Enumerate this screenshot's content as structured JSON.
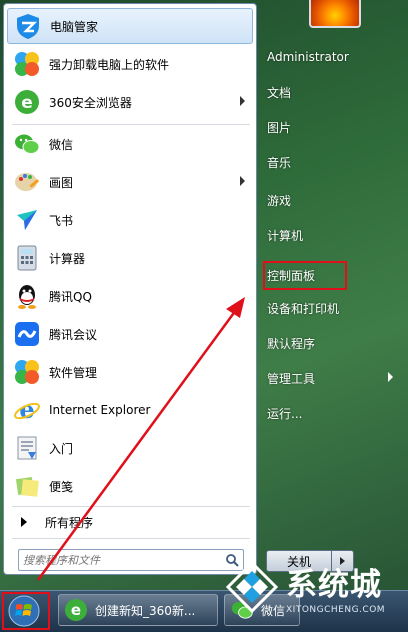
{
  "programs": [
    {
      "label": "电脑管家",
      "icon": "tencent-pc-manager-icon",
      "highlight": true
    },
    {
      "label": "强力卸载电脑上的软件",
      "icon": "uninstaller-icon"
    },
    {
      "label": "360安全浏览器",
      "icon": "360-browser-icon",
      "submenu": true
    },
    {
      "label": "微信",
      "icon": "wechat-icon"
    },
    {
      "label": "画图",
      "icon": "paint-icon",
      "submenu": true
    },
    {
      "label": "飞书",
      "icon": "feishu-icon"
    },
    {
      "label": "计算器",
      "icon": "calculator-icon"
    },
    {
      "label": "腾讯QQ",
      "icon": "qq-icon"
    },
    {
      "label": "腾讯会议",
      "icon": "tencent-meeting-icon"
    },
    {
      "label": "软件管理",
      "icon": "software-manager-icon"
    },
    {
      "label": "Internet Explorer",
      "icon": "internet-explorer-icon"
    },
    {
      "label": "入门",
      "icon": "getting-started-icon"
    },
    {
      "label": "便笺",
      "icon": "sticky-notes-icon"
    }
  ],
  "all_programs_label": "所有程序",
  "search": {
    "placeholder": "搜索程序和文件"
  },
  "right_menu": {
    "user": "Administrator",
    "items": [
      "文档",
      "图片",
      "音乐",
      "游戏",
      "计算机",
      "控制面板",
      "设备和打印机",
      "默认程序",
      "管理工具",
      "运行..."
    ]
  },
  "shutdown_label": "关机",
  "taskbar": {
    "items": [
      {
        "label": "创建新知_360新...",
        "icon": "360-browser-icon"
      },
      {
        "label": "微信",
        "icon": "wechat-icon"
      }
    ]
  },
  "watermark": {
    "title": "系统城",
    "subtitle": "XITONGCHENG.COM"
  },
  "colors": {
    "highlight_box": "#e0101a",
    "annotation_arrow": "#e0101a",
    "desktop": "#2e6b3a"
  }
}
